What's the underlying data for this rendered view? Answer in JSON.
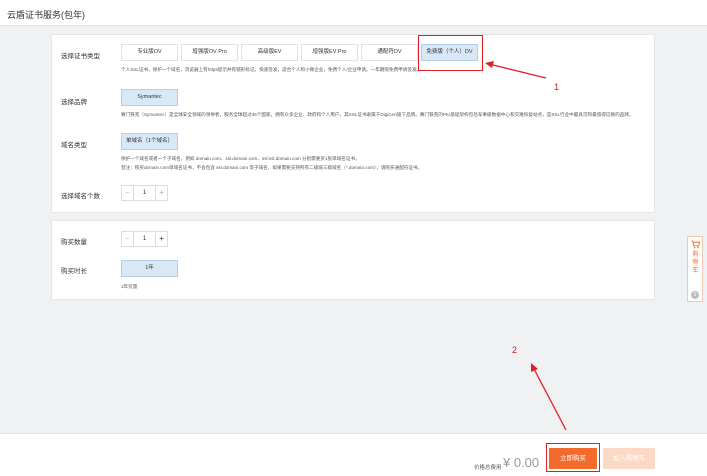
{
  "page": {
    "title": "云盾证书服务(包年)"
  },
  "cert_type": {
    "label": "选择证书类型",
    "options": [
      "专业版OV",
      "增强版OV Pro",
      "高级版EV",
      "增强版EV Pro",
      "通配符DV",
      "免费版（个人）DV"
    ],
    "selected_index": 5,
    "desc": "个人SSL证书，保护一个域名，浏览器上有https提示并有锁形标记。快速签发，适合个人和小微企业，免费个人/企业申请。一年期限免费申请签发。"
  },
  "brand": {
    "label": "选择品牌",
    "options": [
      "Symantec"
    ],
    "desc": "赛门铁克（Symantec）是全球安全领域的领导者，服务全球超过35个国家，拥有众多企业、政府和个人用户。其SSL证书隶属于DigiCert旗下品牌。赛门铁克的PKI基础架构包括军事级数据中心和灾难恢复站点，是SSL行业中最具可和最值得信赖的品牌。"
  },
  "domain_type": {
    "label": "域名类型",
    "options": [
      "单域名（1个域名）"
    ],
    "desc1": "保护一个域名或者一个子域名，例如 domain.com、ssl.domain.com、ssl.ssl.domain.com 分别需要买1张单域名证书。",
    "desc2": "登注：购买domain.com单域名证书，不会包含 ssl.domain.com 等子域名，如果需要支持所有二级域三级域名（*.domain.com），请购买通配符证书。"
  },
  "domain_count": {
    "label": "选择域名个数",
    "value": "1",
    "minus": "−",
    "plus": "+"
  },
  "quantity": {
    "label": "购买数量",
    "value": "1",
    "minus": "−",
    "plus": "+"
  },
  "duration": {
    "label": "购买时长",
    "options": [
      "1年"
    ],
    "note": "1年仅量"
  },
  "side_cart": {
    "label": "购物车",
    "count": "0"
  },
  "bottom": {
    "fee_label": "价格总费用",
    "price": "¥ 0.00",
    "buy_label": "立即购买",
    "cart_label": "加入购物车"
  },
  "annotations": {
    "one": "1",
    "two": "2"
  },
  "colors": {
    "accent": "#f26b2a",
    "selected": "#d8e8f7",
    "annotation": "#e02020"
  }
}
